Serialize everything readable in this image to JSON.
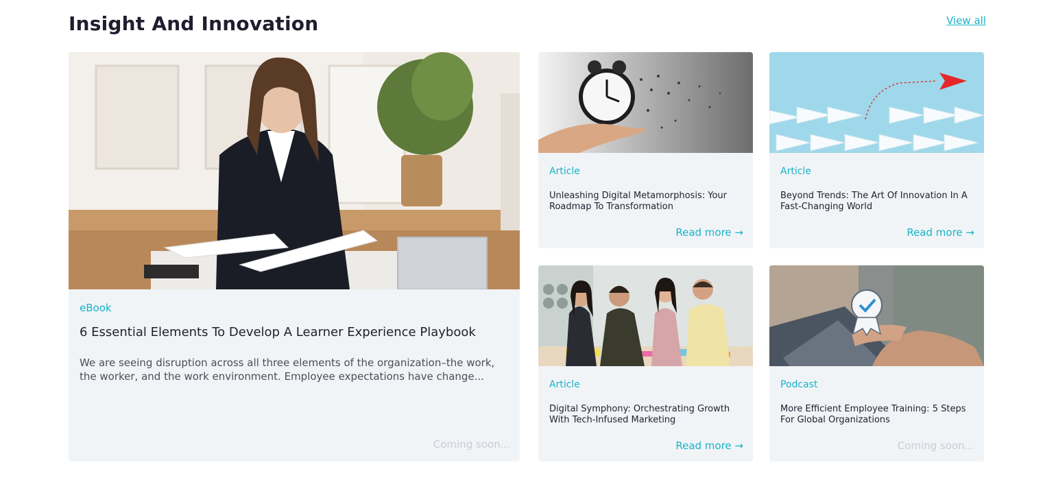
{
  "section": {
    "title": "Insight And Innovation",
    "view_all_label": "View all"
  },
  "featured": {
    "tag": "eBook",
    "title": "6 Essential Elements To Develop A Learner Experience Playbook",
    "excerpt": "We are seeing disruption across all three elements of the organization–the work, the worker, and the work environment. Employee expectations have change...",
    "status": "Coming soon..."
  },
  "cards": [
    {
      "tag": "Article",
      "title": "Unleashing Digital Metamorphosis: Your Roadmap To Transformation",
      "action": "Read more →"
    },
    {
      "tag": "Article",
      "title": "Beyond Trends: The Art Of Innovation In A Fast-Changing World",
      "action": "Read more →"
    },
    {
      "tag": "Article",
      "title": "Digital Symphony: Orchestrating Growth With Tech-Infused Marketing",
      "action": "Read more →"
    },
    {
      "tag": "Podcast",
      "title": "More Efficient Employee Training: 5 Steps For Global Organizations",
      "status": "Coming soon..."
    }
  ],
  "colors": {
    "accent": "#17b3c9",
    "card_background": "#f1f4f7",
    "muted_text": "#c9ced4"
  }
}
